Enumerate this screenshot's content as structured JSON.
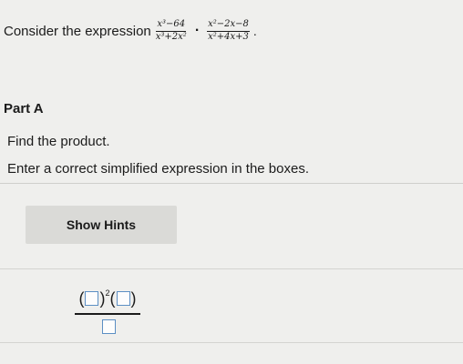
{
  "problem": {
    "prompt": "Consider the expression",
    "fraction1": {
      "num": "x³−64",
      "den": "x³+2x²"
    },
    "operator": "·",
    "fraction2": {
      "num": "x²−2x−8",
      "den": "x²+4x+3"
    },
    "end": "."
  },
  "part": {
    "title": "Part A",
    "instruction": "Find the product.",
    "answer_instruction": "Enter a correct simplified expression in the boxes."
  },
  "hints": {
    "button_label": "Show Hints"
  },
  "answer": {
    "exponent": "2",
    "open_paren": "(",
    "close_paren": ")",
    "numerator_box1_value": "",
    "numerator_box2_value": "",
    "denominator_box_value": ""
  }
}
